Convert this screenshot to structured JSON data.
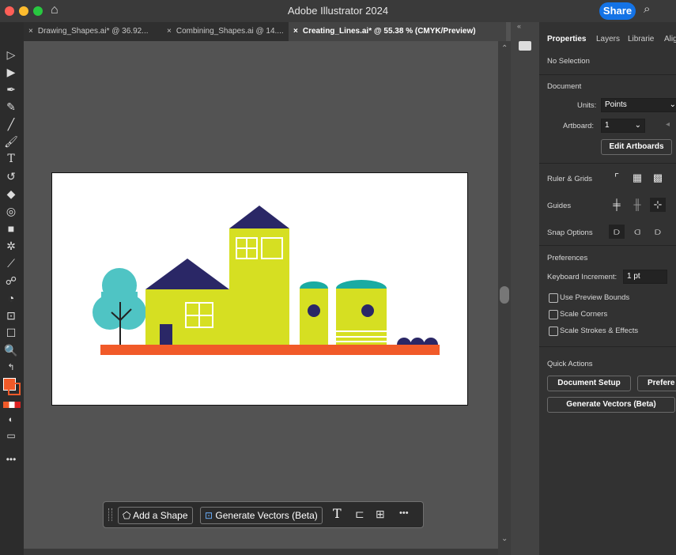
{
  "app": {
    "title": "Adobe Illustrator 2024",
    "share_label": "Share"
  },
  "tabs": [
    {
      "label": "Drawing_Shapes.ai* @ 36.92..."
    },
    {
      "label": "Combining_Shapes.ai @ 14...."
    },
    {
      "label": "Creating_Lines.ai* @ 55.38 % (CMYK/Preview)"
    }
  ],
  "tab_close_glyph": "×",
  "panel": {
    "tabs": [
      "Properties",
      "Layers",
      "Librarie",
      "Alig"
    ],
    "selection": "No Selection",
    "document_section": "Document",
    "units_label": "Units:",
    "units_value": "Points",
    "artboard_label": "Artboard:",
    "artboard_value": "1",
    "edit_artboards": "Edit Artboards",
    "ruler_grids": "Ruler & Grids",
    "guides": "Guides",
    "snap_options": "Snap Options",
    "preferences_section": "Preferences",
    "keyboard_increment_label": "Keyboard Increment:",
    "keyboard_increment_value": "1 pt",
    "use_preview_bounds": "Use Preview Bounds",
    "scale_corners": "Scale Corners",
    "scale_strokes": "Scale Strokes & Effects",
    "quick_actions": "Quick Actions",
    "document_setup": "Document Setup",
    "preferences_btn": "Prefere",
    "generate_vectors": "Generate Vectors (Beta)"
  },
  "context_bar": {
    "add_shape": "Add a Shape",
    "generate_vectors": "Generate Vectors (Beta)",
    "more": "•••"
  },
  "colors": {
    "house_body": "#d6df22",
    "roof": "#2a2766",
    "ground": "#f15a29",
    "teal": "#1aaba2",
    "tree": "#4fc4c4"
  }
}
